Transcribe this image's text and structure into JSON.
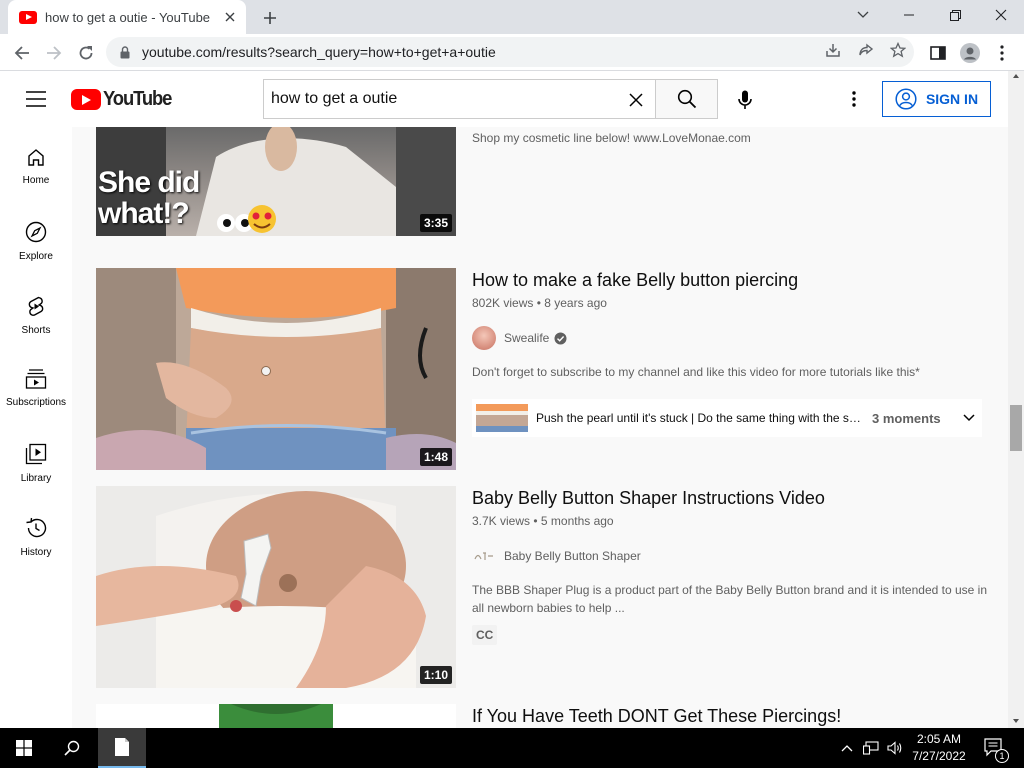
{
  "browser": {
    "tab_title": "how to get a outie - YouTube",
    "url": "youtube.com/results?search_query=how+to+get+a+outie"
  },
  "youtube": {
    "logo_text": "YouTube",
    "search_query": "how to get a outie",
    "sign_in": "SIGN IN"
  },
  "sidebar": [
    {
      "label": "Home",
      "icon": "home-icon"
    },
    {
      "label": "Explore",
      "icon": "compass-icon"
    },
    {
      "label": "Shorts",
      "icon": "shorts-icon"
    },
    {
      "label": "Subscriptions",
      "icon": "subscriptions-icon"
    },
    {
      "label": "Library",
      "icon": "library-icon"
    },
    {
      "label": "History",
      "icon": "history-icon"
    }
  ],
  "results": [
    {
      "description": "Shop my cosmetic line below! www.LoveMonae.com",
      "thumb_overlay_line1": "She did",
      "thumb_overlay_line2": "what!?",
      "duration": "3:35"
    },
    {
      "title": "How to make a fake Belly button piercing",
      "meta": "802K views • 8 years ago",
      "channel": "Swealife",
      "verified": true,
      "description": "Don't forget to subscribe to my channel and like this video for more tutorials like this*",
      "duration": "1:48",
      "moments_text": "Push the pearl until it's stuck | Do the same thing with the small",
      "moments_count": "3 moments"
    },
    {
      "title": "Baby Belly Button Shaper Instructions Video",
      "meta": "3.7K views • 5 months ago",
      "channel": "Baby Belly Button Shaper",
      "description": "The BBB Shaper Plug is a product part of the Baby Belly Button brand and it is intended to use in all newborn babies to help ...",
      "badge": "CC",
      "duration": "1:10"
    },
    {
      "title": "If You Have Teeth DONT Get These Piercings!"
    }
  ],
  "taskbar": {
    "time": "2:05 AM",
    "date": "7/27/2022",
    "notification_count": "1"
  }
}
